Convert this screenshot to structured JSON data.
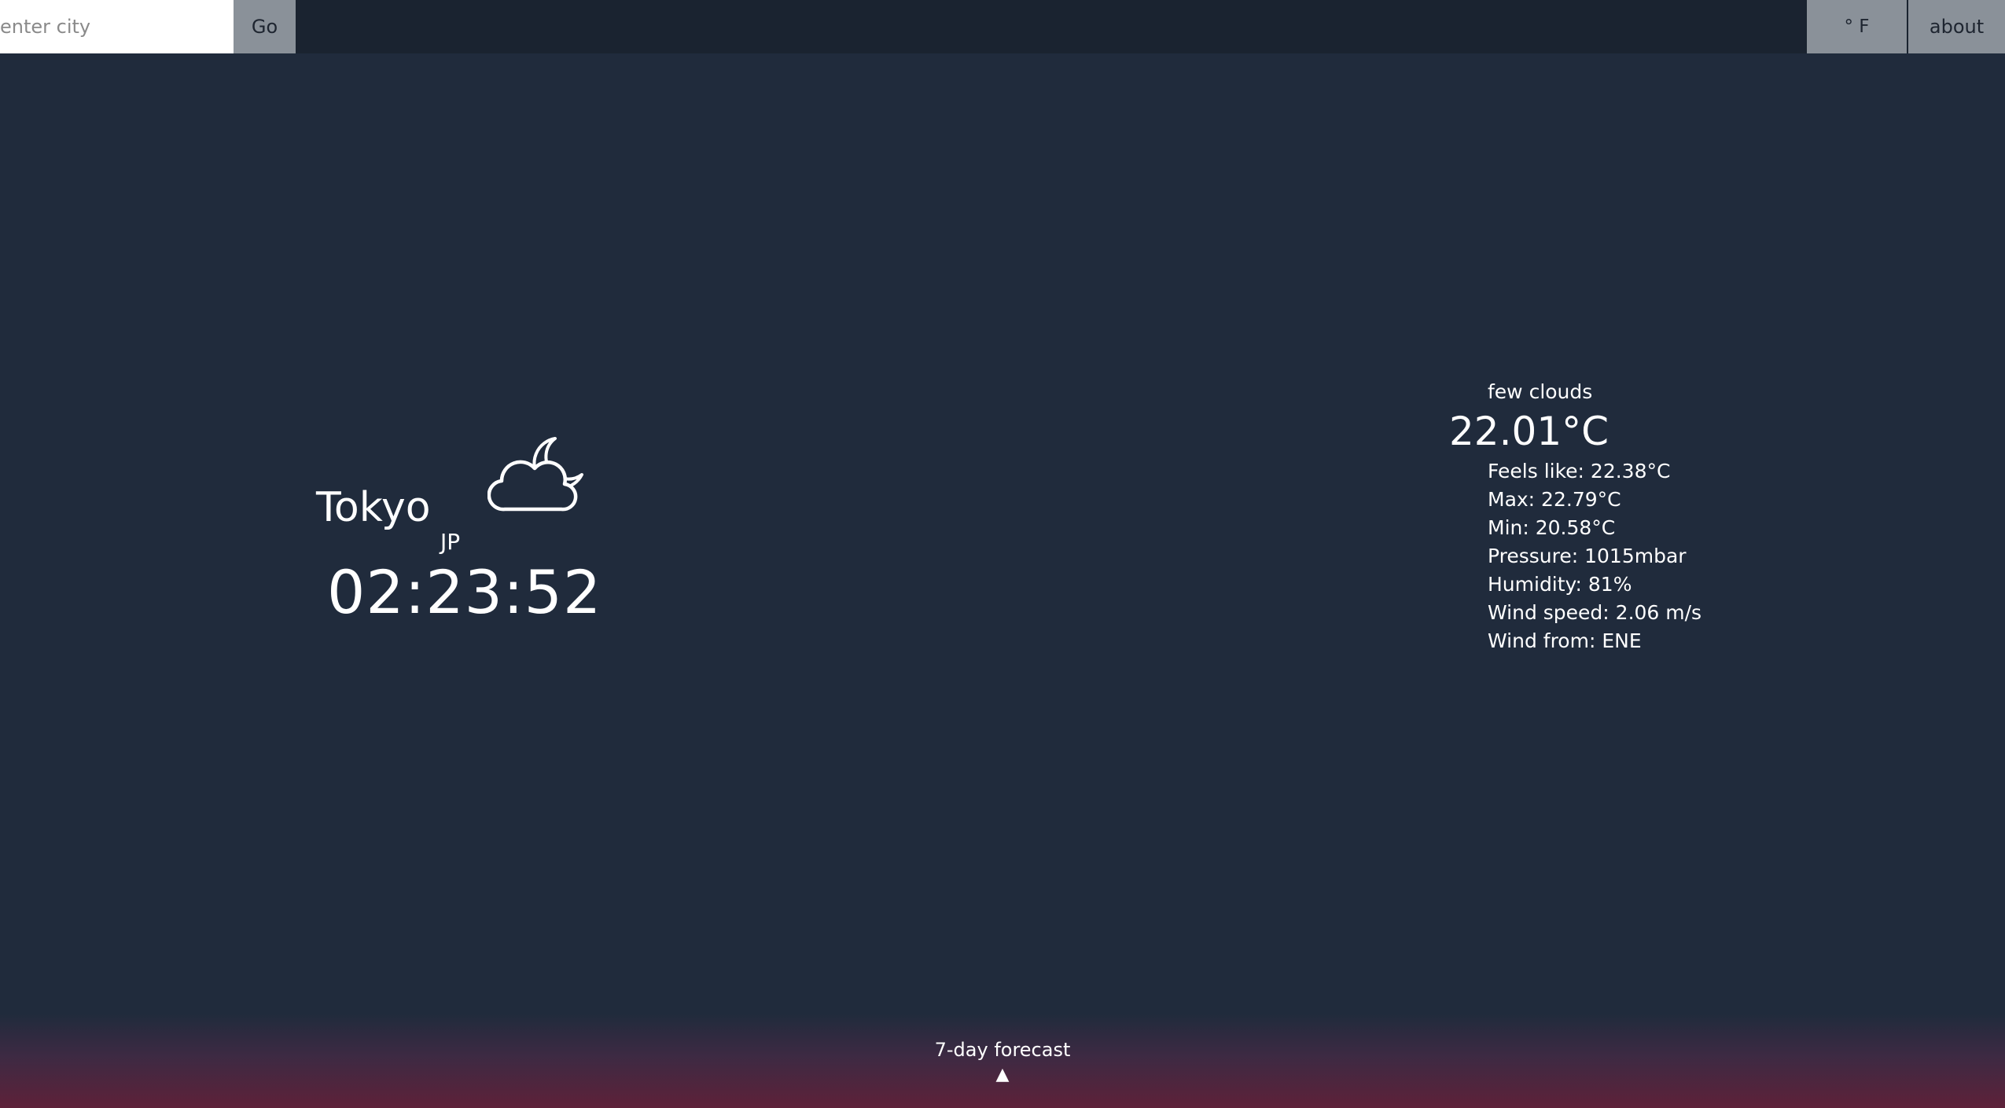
{
  "search": {
    "placeholder": "enter city",
    "value": "",
    "go_label": "Go"
  },
  "header": {
    "unit_toggle_label": "° F",
    "about_label": "about"
  },
  "location": {
    "city": "Tokyo",
    "country": "JP",
    "time": "02:23:52",
    "icon": "few-clouds-night-icon"
  },
  "weather": {
    "description": "few clouds",
    "temperature": "22.01°C",
    "details": [
      "Feels like: 22.38°C",
      "Max: 22.79°C",
      "Min: 20.58°C",
      "Pressure: 1015mbar",
      "Humidity: 81%",
      "Wind speed: 2.06 m/s",
      "Wind from: ENE"
    ]
  },
  "forecast": {
    "label": "7-day forecast",
    "arrow": "▲"
  },
  "colors": {
    "background": "#202b3c",
    "topbar": "#1a2330",
    "button": "#8a9199",
    "forecast_gradient_end": "#5e2139"
  }
}
